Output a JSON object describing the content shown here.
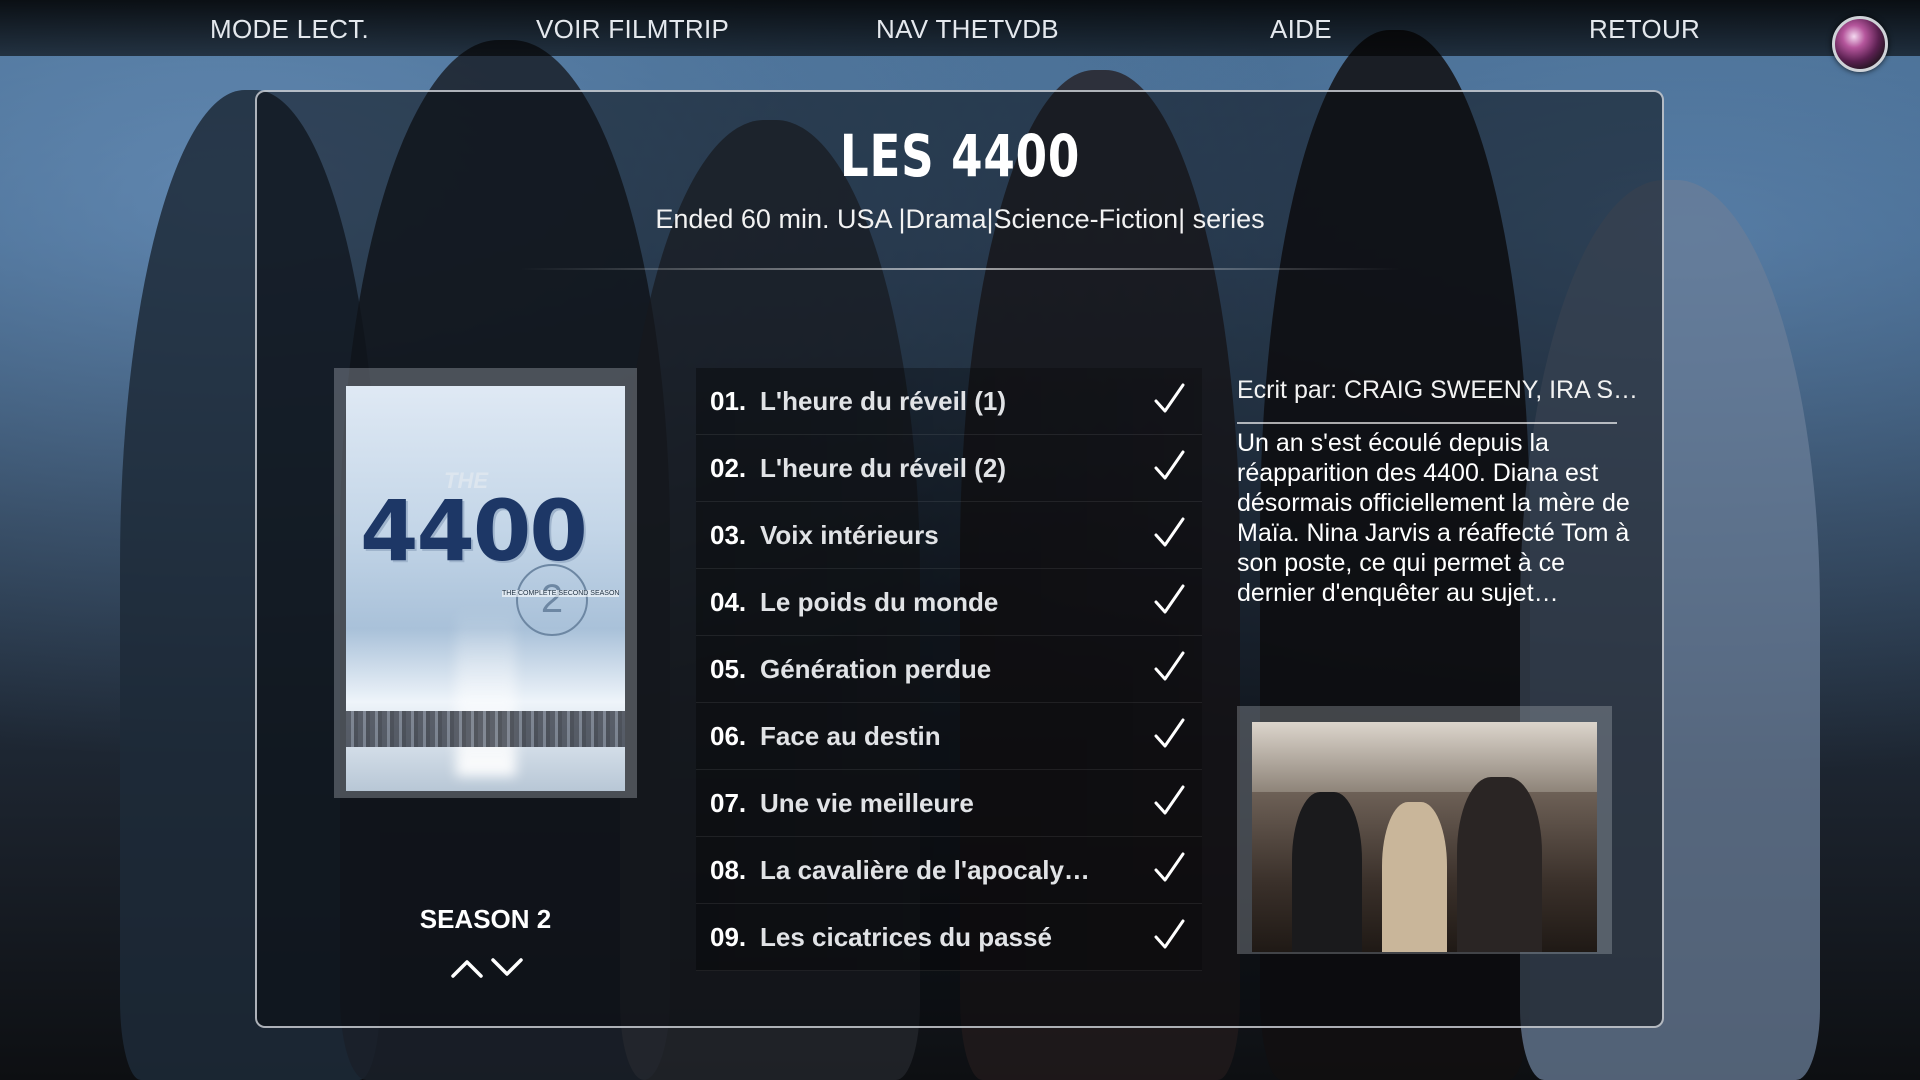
{
  "nav": {
    "items": [
      "MODE LECT.",
      "VOIR FILMTRIP",
      "NAV THETVDB",
      "AIDE",
      "RETOUR"
    ]
  },
  "show": {
    "title": "LES 4400",
    "info": "Ended 60 min. USA |Drama|Science-Fiction| series"
  },
  "season": {
    "label": "SEASON 2"
  },
  "episodes": [
    {
      "num": "01.",
      "title": "L'heure du réveil (1)",
      "watched": true
    },
    {
      "num": "02.",
      "title": "L'heure du réveil (2)",
      "watched": true
    },
    {
      "num": "03.",
      "title": "Voix intérieurs",
      "watched": true
    },
    {
      "num": "04.",
      "title": "Le poids du monde",
      "watched": true
    },
    {
      "num": "05.",
      "title": "Génération perdue",
      "watched": true
    },
    {
      "num": "06.",
      "title": "Face au destin",
      "watched": true
    },
    {
      "num": "07.",
      "title": "Une vie meilleure",
      "watched": true
    },
    {
      "num": "08.",
      "title": "La cavalière de l'apocaly…",
      "watched": true
    },
    {
      "num": "09.",
      "title": "Les cicatrices du passé",
      "watched": true
    }
  ],
  "details": {
    "writer": "Ecrit par: CRAIG SWEENY, IRA S…",
    "plot": "Un an s'est écoulé depuis la réapparition des 4400. Diana est désormais officiellement la mère de Maïa. Nina Jarvis a réaffecté Tom à son poste, ce qui permet à ce dernier d'enquêter au sujet…"
  },
  "poster": {
    "the": "THE",
    "number": "4400",
    "season_num": "2",
    "tagline": "THE COMPLETE SECOND SEASON"
  },
  "colors": {
    "accent": "#ffffff",
    "panel_border": "#e1e6ec"
  },
  "icons": {
    "checkmark": "check-icon",
    "up": "chevron-up-icon",
    "down": "chevron-down-icon"
  }
}
